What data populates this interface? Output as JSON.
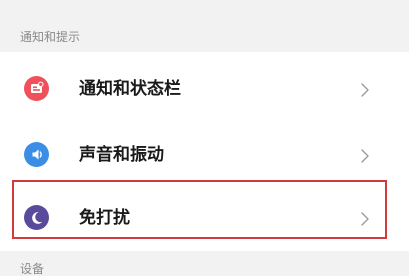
{
  "sections": {
    "notifications_header": "通知和提示",
    "device_header": "设备"
  },
  "items": [
    {
      "label": "通知和状态栏",
      "icon": "notification-bar-icon",
      "icon_color": "#f0505a"
    },
    {
      "label": "声音和振动",
      "icon": "sound-vibration-icon",
      "icon_color": "#3a8ee6"
    },
    {
      "label": "免打扰",
      "icon": "moon-icon",
      "icon_color": "#5a4a9c"
    }
  ],
  "colors": {
    "highlight_border": "#d23b3b",
    "page_background": "#f2f2f2",
    "card_background": "#ffffff"
  }
}
